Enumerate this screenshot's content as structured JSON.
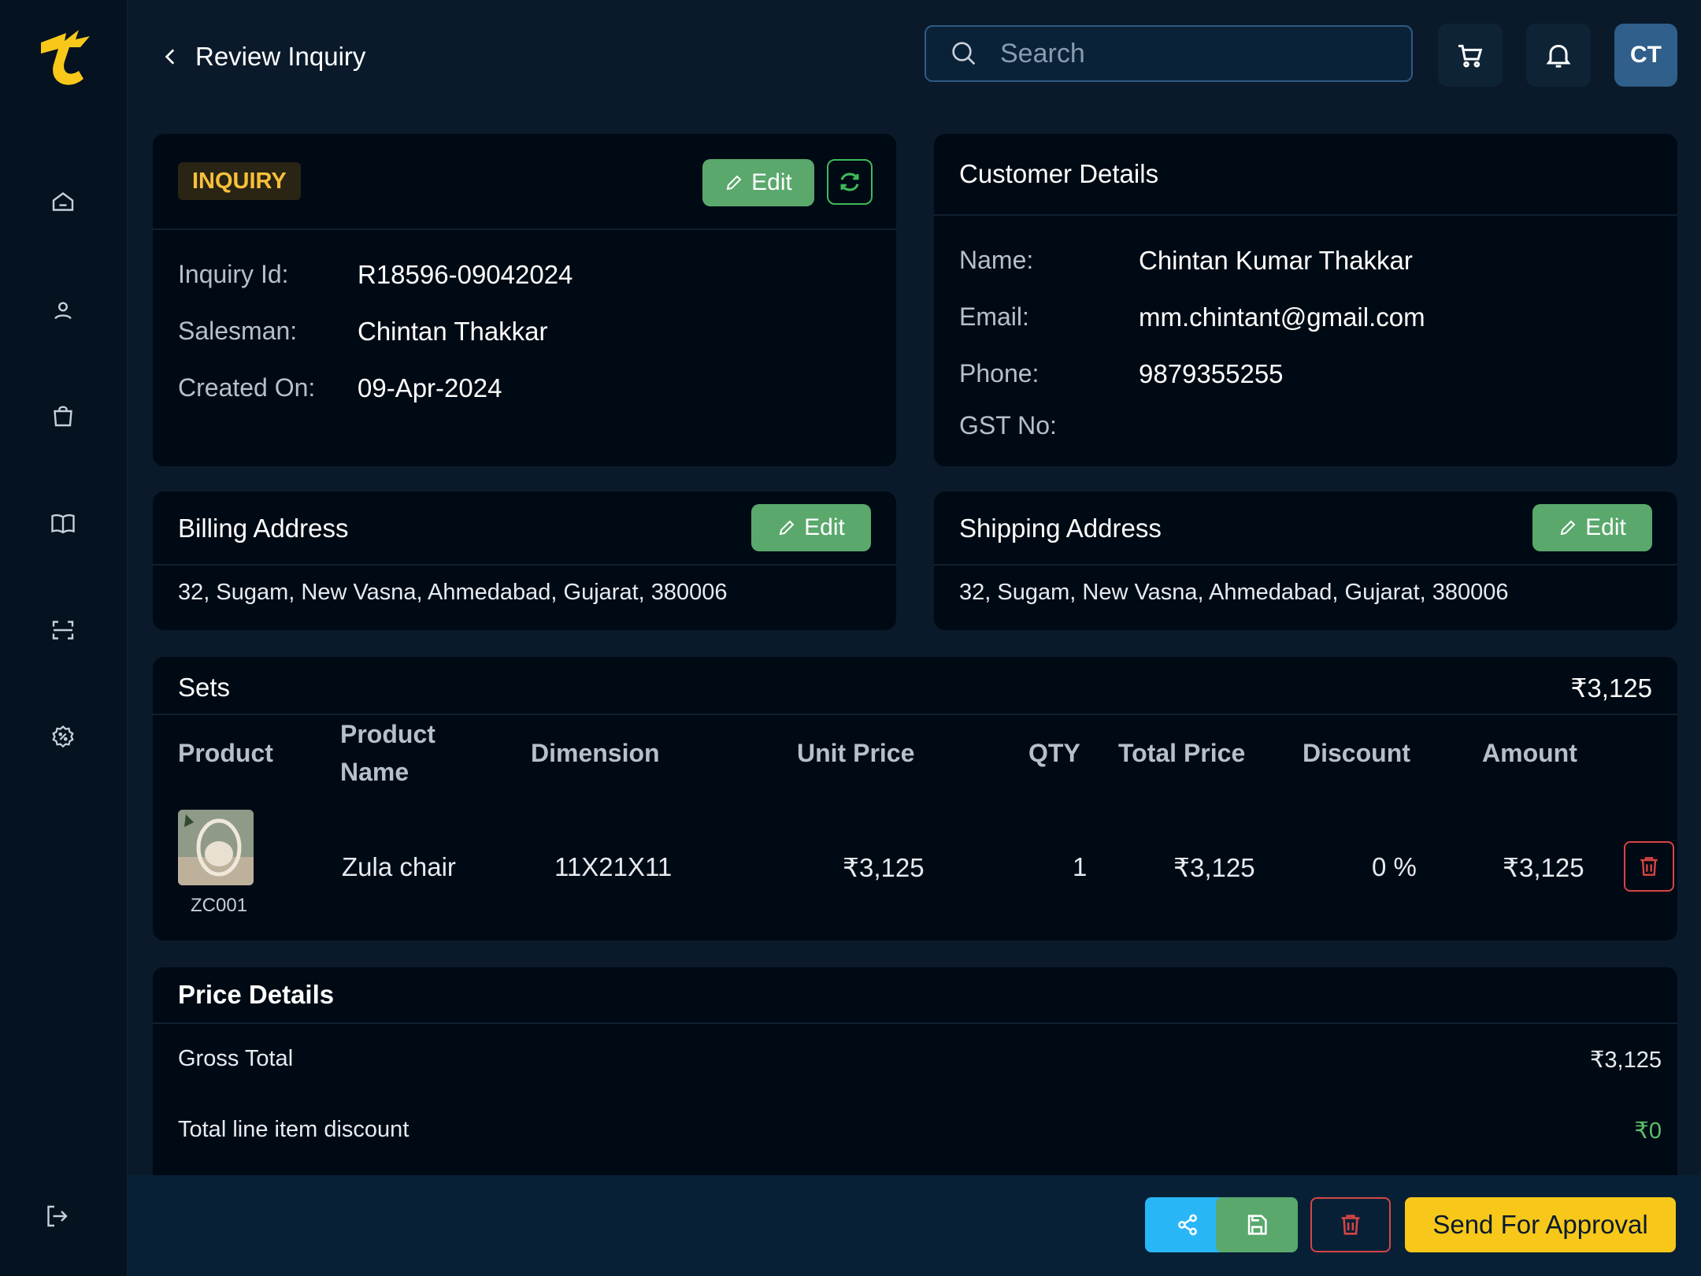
{
  "header": {
    "title": "Review Inquiry",
    "search_placeholder": "Search",
    "avatar_initials": "CT"
  },
  "sidebar": {
    "items": [
      {
        "name": "home-icon"
      },
      {
        "name": "user-icon"
      },
      {
        "name": "shopping-bag-icon"
      },
      {
        "name": "book-icon"
      },
      {
        "name": "scan-icon"
      },
      {
        "name": "discount-icon"
      }
    ],
    "logout": "logout-icon"
  },
  "inquiry": {
    "badge": "INQUIRY",
    "edit_label": "Edit",
    "fields": [
      {
        "label": "Inquiry Id:",
        "value": "R18596-09042024"
      },
      {
        "label": "Salesman:",
        "value": "Chintan Thakkar"
      },
      {
        "label": "Created On:",
        "value": "09-Apr-2024"
      }
    ]
  },
  "customer": {
    "title": "Customer Details",
    "fields": [
      {
        "label": "Name:",
        "value": "Chintan Kumar Thakkar"
      },
      {
        "label": "Email:",
        "value": "mm.chintant@gmail.com"
      },
      {
        "label": "Phone:",
        "value": "9879355255"
      },
      {
        "label": "GST No:",
        "value": ""
      }
    ]
  },
  "billing": {
    "title": "Billing Address",
    "edit_label": "Edit",
    "address": "32, Sugam, New Vasna, Ahmedabad, Gujarat, 380006"
  },
  "shipping": {
    "title": "Shipping Address",
    "edit_label": "Edit",
    "address": "32, Sugam, New Vasna, Ahmedabad, Gujarat, 380006"
  },
  "sets": {
    "title": "Sets",
    "total": "₹3,125",
    "columns": {
      "product": "Product",
      "product_name_1": "Product",
      "product_name_2": "Name",
      "dimension": "Dimension",
      "unit_price": "Unit Price",
      "qty": "QTY",
      "total_price": "Total Price",
      "discount": "Discount",
      "amount": "Amount"
    },
    "rows": [
      {
        "sku": "ZC001",
        "name": "Zula chair",
        "dimension": "11X21X11",
        "unit_price": "₹3,125",
        "qty": "1",
        "total_price": "₹3,125",
        "discount": "0 %",
        "amount": "₹3,125"
      }
    ]
  },
  "price_details": {
    "title": "Price Details",
    "rows": [
      {
        "label": "Gross Total",
        "value": "₹3,125"
      },
      {
        "label": "Total line item discount",
        "value": "₹0"
      }
    ]
  },
  "footer": {
    "approve_label": "Send For Approval"
  },
  "colors": {
    "accent_yellow": "#f7c81a",
    "edit_green": "#5aa86c",
    "share_blue": "#29b6f6",
    "danger_red": "#d64545",
    "discount_green": "#5bbf6a"
  }
}
